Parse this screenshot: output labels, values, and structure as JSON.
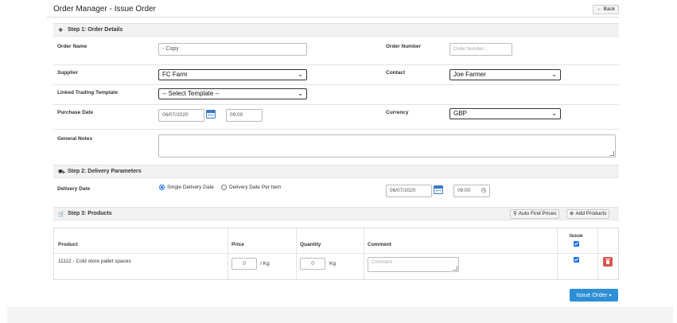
{
  "header": {
    "title": "Order Manager - Issue Order",
    "back_label": "Back"
  },
  "step1": {
    "title": "Step 1: Order Details",
    "order_name_label": "Order Name",
    "order_name_value": "- Copy",
    "order_number_label": "Order Number",
    "order_number_placeholder": "Order Number...",
    "supplier_label": "Supplier",
    "supplier_value": "FC Farm",
    "contact_label": "Contact",
    "contact_value": "Joe Farmer",
    "template_label": "Linked Trading Template",
    "template_value": "-- Select Template --",
    "purchase_date_label": "Purchase Date",
    "purchase_date_value": "06/07/2020",
    "purchase_time_value": "09:00",
    "currency_label": "Currency",
    "currency_value": "GBP",
    "notes_label": "General Notes",
    "notes_value": ""
  },
  "step2": {
    "title": "Step 2: Delivery Parameters",
    "delivery_date_label": "Delivery Date",
    "option_single": "Single Delivery Date",
    "option_per_item": "Delivery Date Per Item",
    "selected_option": "single",
    "delivery_date_value": "06/07/2020",
    "delivery_time_value": "09:00"
  },
  "step3": {
    "title": "Step 3: Products",
    "auto_find_label": "Auto Find Prices",
    "add_products_label": "Add Products",
    "columns": {
      "product": "Product",
      "price": "Price",
      "quantity": "Quantity",
      "comment": "Comment",
      "issue": "Issue"
    },
    "rows": [
      {
        "product": "11112 - Cold store pallet spaces",
        "price": "0",
        "price_unit": "/ Kg",
        "quantity": "0",
        "quantity_unit": "Kg",
        "comment_placeholder": "Comment",
        "issue": true
      }
    ]
  },
  "actions": {
    "issue_order_label": "Issue Order"
  },
  "colors": {
    "primary": "#2d8fd6",
    "danger": "#d9534f",
    "header_bg": "#f2f2f2"
  }
}
